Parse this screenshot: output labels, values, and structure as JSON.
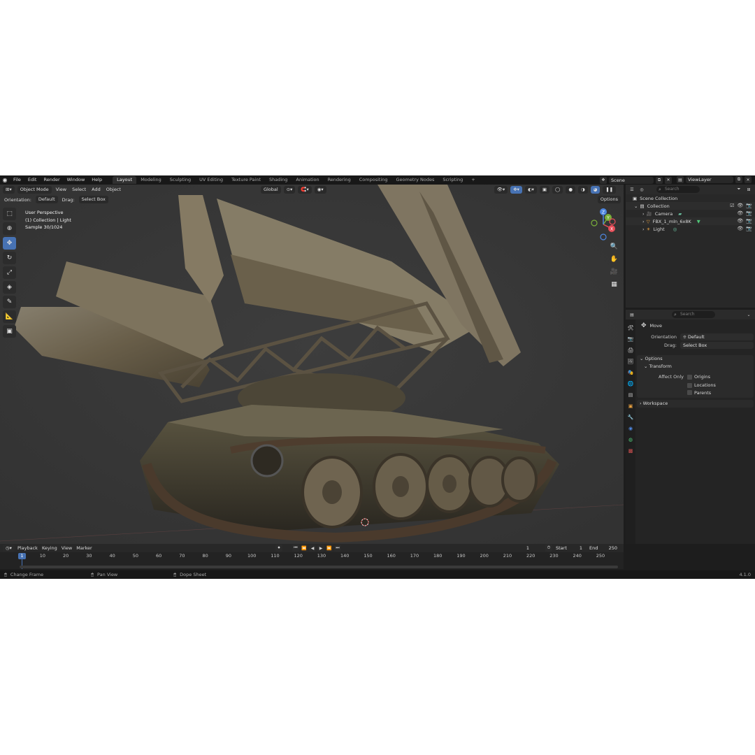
{
  "menu": [
    "File",
    "Edit",
    "Render",
    "Window",
    "Help"
  ],
  "workspaces": [
    {
      "label": "Layout",
      "active": true
    },
    {
      "label": "Modeling"
    },
    {
      "label": "Sculpting"
    },
    {
      "label": "UV Editing"
    },
    {
      "label": "Texture Paint"
    },
    {
      "label": "Shading"
    },
    {
      "label": "Animation"
    },
    {
      "label": "Rendering"
    },
    {
      "label": "Compositing"
    },
    {
      "label": "Geometry Nodes"
    },
    {
      "label": "Scripting"
    }
  ],
  "add_workspace": "+",
  "scene": "Scene",
  "view_layer": "ViewLayer",
  "viewport": {
    "mode": "Object Mode",
    "menus": [
      "View",
      "Select",
      "Add",
      "Object"
    ],
    "transform_orientation": "Global",
    "orientation_label": "Orientation:",
    "orientation_value": "Default",
    "drag_label": "Drag:",
    "drag_value": "Select Box",
    "options": "Options",
    "info_line1": "User Perspective",
    "info_line2": "(1) Collection | Light",
    "info_line3": "Sample 30/1024",
    "gizmo_axes": {
      "x": "X",
      "y": "Y",
      "z": "Z"
    }
  },
  "outliner": {
    "search_placeholder": "Search",
    "scene_collection": "Scene Collection",
    "collection": "Collection",
    "items": [
      "Camera",
      "FBX_1_mln_6x8K",
      "Light"
    ]
  },
  "properties": {
    "search_placeholder": "Search",
    "tool_name": "Move",
    "orientation_label": "Orientation",
    "orientation_value": "Default",
    "drag_label": "Drag:",
    "drag_value": "Select Box",
    "options_panel": "Options",
    "transform_panel": "Transform",
    "affect_only": "Affect Only",
    "checkboxes": [
      "Origins",
      "Locations",
      "Parents"
    ],
    "workspace_panel": "Workspace"
  },
  "timeline": {
    "menus": [
      "Playback",
      "Keying",
      "View",
      "Marker"
    ],
    "current_frame": "1",
    "start_label": "Start",
    "start_value": "1",
    "end_label": "End",
    "end_value": "250",
    "ticks": [
      "10",
      "20",
      "30",
      "40",
      "50",
      "60",
      "70",
      "80",
      "90",
      "100",
      "110",
      "120",
      "130",
      "140",
      "150",
      "160",
      "170",
      "180",
      "190",
      "200",
      "210",
      "220",
      "230",
      "240",
      "250"
    ],
    "playhead_label": "1"
  },
  "status": {
    "change_frame": "Change Frame",
    "pan_view": "Pan View",
    "dope_sheet": "Dope Sheet",
    "version": "4.1.0"
  },
  "colors": {
    "accent": "#4772b3",
    "axis_x": "#e84d58",
    "axis_y": "#7ab03a",
    "axis_z": "#4f87e0"
  }
}
